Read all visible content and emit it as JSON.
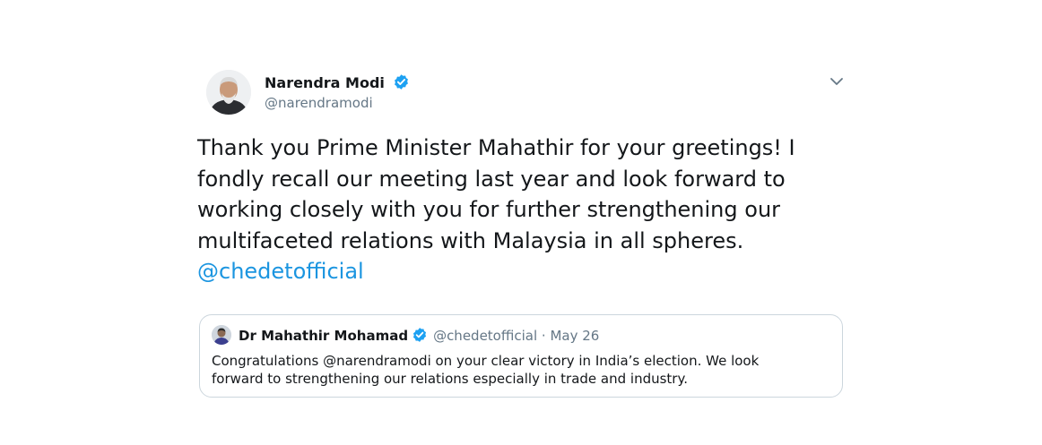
{
  "tweet": {
    "author": {
      "name": "Narendra Modi",
      "handle": "@narendramodi",
      "verified": true
    },
    "text": {
      "line1": "Thank you Prime Minister Mahathir for your greetings! I",
      "line2": "fondly recall our meeting last year and look forward to",
      "line3": "working closely with you for further strengthening our",
      "line4": "multifaceted relations with Malaysia in all spheres.",
      "mention": "@chedetofficial"
    },
    "menu_icon": "chevron-down-icon"
  },
  "quoted_tweet": {
    "author": {
      "name": "Dr Mahathir Mohamad",
      "handle": "@chedetofficial",
      "separator": "·",
      "date": "May 26",
      "verified": true
    },
    "text": {
      "line1": "Congratulations @narendramodi on your clear victory in India’s election. We look",
      "line2": "forward to strengthening our relations especially in trade and industry."
    }
  },
  "colors": {
    "text": "#14171a",
    "secondary": "#657786",
    "link": "#1b95e0",
    "border": "#ccd6dd",
    "verified": "#1da1f2"
  }
}
